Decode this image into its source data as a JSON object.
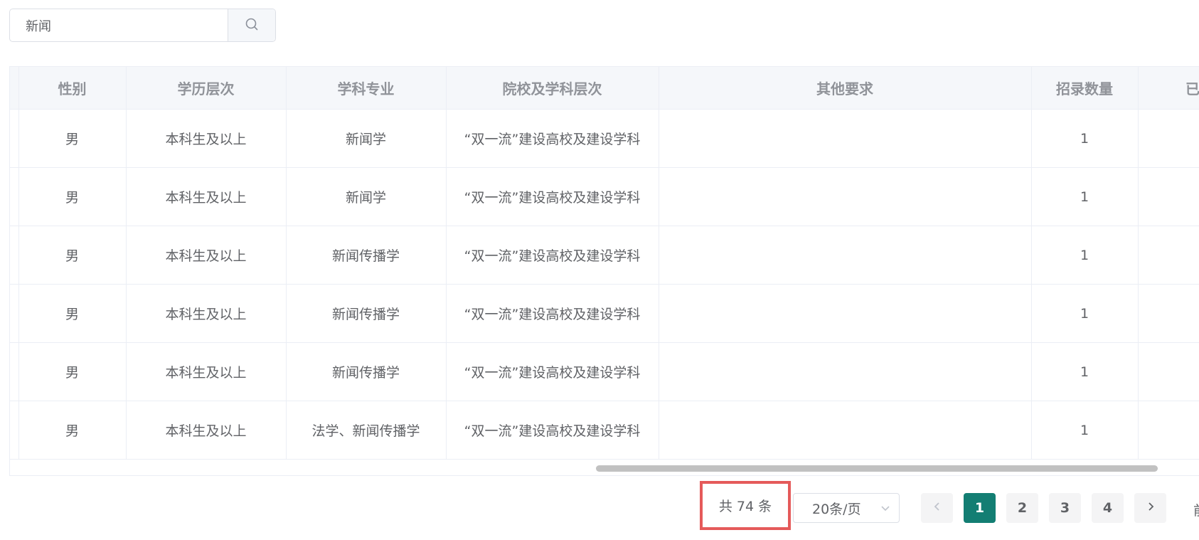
{
  "search": {
    "value": "新闻",
    "placeholder": ""
  },
  "table": {
    "headers": [
      "",
      "性别",
      "学历层次",
      "学科专业",
      "院校及学科层次",
      "其他要求",
      "招录数量",
      "已报名"
    ],
    "rows": [
      [
        "",
        "男",
        "本科生及以上",
        "新闻学",
        "“双一流”建设高校及建设学科",
        "",
        "1",
        ""
      ],
      [
        "",
        "男",
        "本科生及以上",
        "新闻学",
        "“双一流”建设高校及建设学科",
        "",
        "1",
        ""
      ],
      [
        "",
        "男",
        "本科生及以上",
        "新闻传播学",
        "“双一流”建设高校及建设学科",
        "",
        "1",
        ""
      ],
      [
        "",
        "男",
        "本科生及以上",
        "新闻传播学",
        "“双一流”建设高校及建设学科",
        "",
        "1",
        ""
      ],
      [
        "",
        "男",
        "本科生及以上",
        "新闻传播学",
        "“双一流”建设高校及建设学科",
        "",
        "1",
        ""
      ],
      [
        "",
        "男",
        "本科生及以上",
        "法学、新闻传播学",
        "“双一流”建设高校及建设学科",
        "",
        "1",
        ""
      ]
    ]
  },
  "pagination": {
    "total_label": "共 74 条",
    "page_size_label": "20条/页",
    "pages": [
      "1",
      "2",
      "3",
      "4"
    ],
    "current_page": "1",
    "jumper_label": "前"
  },
  "colors": {
    "accent": "#137e73",
    "highlight_border": "#e55a5a",
    "header_bg": "#f5f7fa"
  },
  "icons": {
    "search": "search-icon",
    "prev": "chevron-left-icon",
    "next": "chevron-right-icon",
    "select": "chevron-down-icon"
  }
}
